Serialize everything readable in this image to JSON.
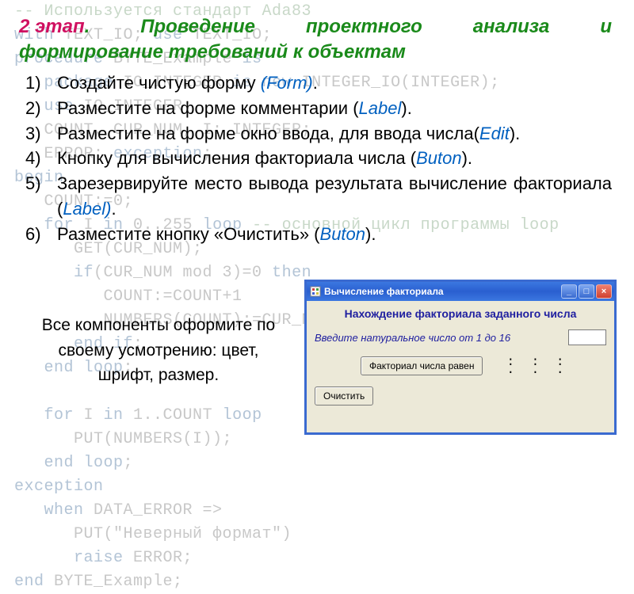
{
  "bgcode": {
    "l1": "-- Используется стандарт Ada83",
    "l2a": "with",
    "l2b": " TEXT_IO; ",
    "l2c": "use",
    "l2d": " TEXT_IO;",
    "l3a": "procedure",
    "l3b": " BYTE_Example ",
    "l3c": "is",
    "l4a": "   package",
    "l4b": " IO_INTEGER ",
    "l4c": "is new",
    "l4d": " INTEGER_IO(INTEGER);",
    "l5a": "   use",
    "l5b": " IO_INTEGER;",
    "l6": "   COUNT, CUR_NUM, I: INTEGER;",
    "l7a": "   ERROR: ",
    "l7b": "exception",
    "l7c": ";",
    "l8": "begin",
    "l9": "   COUNT:=0;",
    "l10a": "   for",
    "l10b": " I ",
    "l10c": "in",
    "l10d": " 0..255 ",
    "l10e": "loop",
    "l10f": " -- основной цикл программы loop",
    "l11": "      GET(CUR_NUM);",
    "l12a": "      if",
    "l12b": "(CUR_NUM mod 3)=0 ",
    "l12c": "then",
    "l13": "         COUNT:=COUNT+1",
    "l14": "         NUMBERS(COUNT):=CUR_NUM",
    "l15a": "      end if",
    "l15b": ";",
    "l16a": "   end loop",
    "l16b": ";",
    "l17": "",
    "l18a": "   for",
    "l18b": " I ",
    "l18c": "in",
    "l18d": " 1..COUNT ",
    "l18e": "loop",
    "l19": "      PUT(NUMBERS(I));",
    "l20a": "   end loop",
    "l20b": ";",
    "l21": "exception",
    "l22a": "   when",
    "l22b": " DATA_ERROR =>",
    "l23": "      PUT(\"Неверный формат\")",
    "l24a": "      raise",
    "l24b": " ERROR;",
    "l25a": "end",
    "l25b": " BYTE_Example;"
  },
  "title": {
    "stage": "2 этап",
    "dot": ".",
    "rest1a": "Проведение",
    "rest1b": "проектного",
    "rest1c": "анализа",
    "rest1d": "и",
    "rest2": "формирование требований к объектам"
  },
  "items": [
    {
      "n": "1)",
      "a": "Создайте чистую форму ",
      "h": "(Form)",
      "b": "."
    },
    {
      "n": "2)",
      "a": "Разместите на форме комментарии (",
      "h": "Label",
      "b": ")."
    },
    {
      "n": "3)",
      "a": "Разместите на форме окно ввода, для ввода числа(",
      "h": "Edit",
      "b": ")."
    },
    {
      "n": "4)",
      "a": "Кнопку для вычисления факториала числа (",
      "h": "Buton",
      "b": ")."
    },
    {
      "n": "5)",
      "a": "Зарезервируйте место вывода результата вычисление факториала (",
      "h": "Label)",
      "b": "."
    },
    {
      "n": "6)",
      "a": "Разместите кнопку «Очистить» (",
      "h": "Buton",
      "b": ")."
    }
  ],
  "note": "Все компоненты оформите по своему усмотрению: цвет, шрифт, размер.",
  "form": {
    "title": "Вычисление факториала",
    "caption": "Нахождение факториала заданного числа",
    "prompt": "Введите натуральное число от 1 до 16",
    "calc": "Факториал числа равен",
    "clear": "Очистить",
    "dots1": ": : :",
    "dots2": ". . .",
    "min": "_",
    "max": "□",
    "close": "×"
  }
}
